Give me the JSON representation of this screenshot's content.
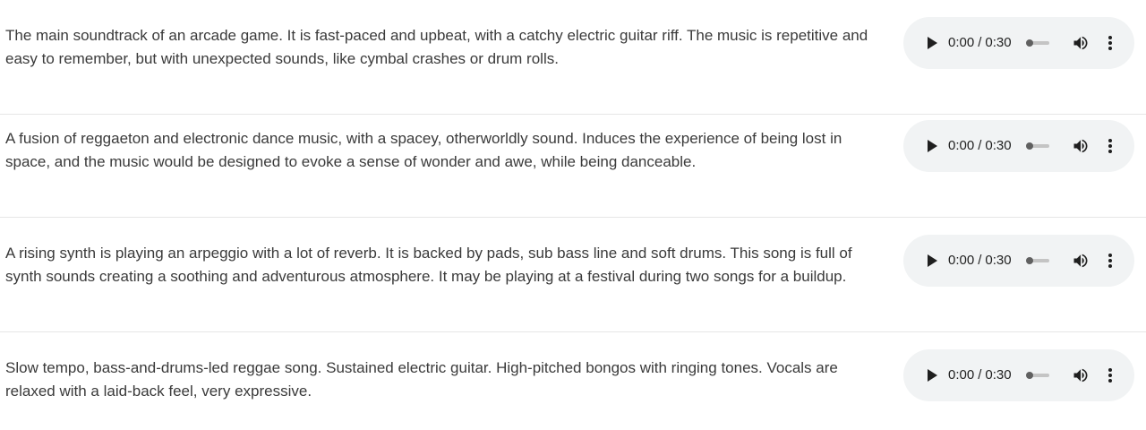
{
  "tracks": [
    {
      "description": "The main soundtrack of an arcade game. It is fast-paced and upbeat, with a catchy electric guitar riff. The music is repetitive and easy to remember, but with unexpected sounds, like cymbal crashes or drum rolls.",
      "player": {
        "current_time": "0:00",
        "duration": "0:30",
        "progress": 0
      }
    },
    {
      "description": "A fusion of reggaeton and electronic dance music, with a spacey, otherworldly sound. Induces the experience of being lost in space, and the music would be designed to evoke a sense of wonder and awe, while being danceable.",
      "player": {
        "current_time": "0:00",
        "duration": "0:30",
        "progress": 0
      }
    },
    {
      "description": "A rising synth is playing an arpeggio with a lot of reverb. It is backed by pads, sub bass line and soft drums. This song is full of synth sounds creating a soothing and adventurous atmosphere. It may be playing at a festival during two songs for a buildup.",
      "player": {
        "current_time": "0:00",
        "duration": "0:30",
        "progress": 0
      }
    },
    {
      "description": "Slow tempo, bass-and-drums-led reggae song. Sustained electric guitar. High-pitched bongos with ringing tones. Vocals are relaxed with a laid-back feel, very expressive.",
      "player": {
        "current_time": "0:00",
        "duration": "0:30",
        "progress": 0
      }
    }
  ],
  "icons": {
    "play": "play-icon",
    "volume": "volume-icon",
    "more": "more-vertical-icon"
  },
  "colors": {
    "player_background": "#f1f3f4",
    "text": "#3a3a3a",
    "divider": "#e6e6e6"
  },
  "separator": "/"
}
